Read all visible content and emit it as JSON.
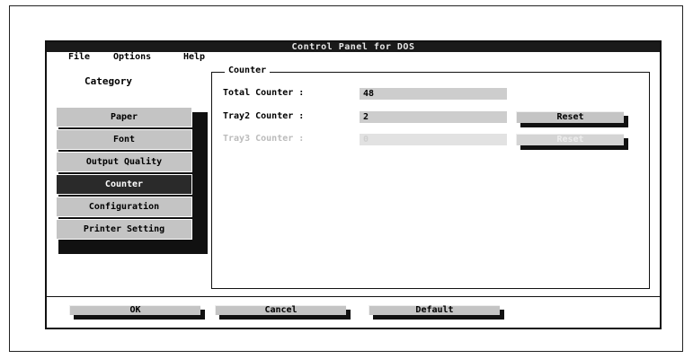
{
  "window": {
    "title": "Control Panel for DOS"
  },
  "menu": {
    "items": [
      "File",
      "Options",
      "Help"
    ]
  },
  "sidebar": {
    "heading": "Category",
    "items": [
      "Paper",
      "Font",
      "Output Quality",
      "Counter",
      "Configuration",
      "Printer Setting"
    ],
    "selected": "Counter"
  },
  "counter": {
    "group_title": "Counter",
    "rows": [
      {
        "label": "Total Counter :",
        "value": "48",
        "enabled": true
      },
      {
        "label": "Tray2 Counter :",
        "value": "2",
        "enabled": true,
        "button": "Reset"
      },
      {
        "label": "Tray3 Counter :",
        "value": "0",
        "enabled": false,
        "button": "Reset"
      }
    ]
  },
  "footer": {
    "ok": "OK",
    "cancel": "Cancel",
    "default": "Default"
  },
  "colors": {
    "titlebar": "#1a1a1a",
    "button_face": "#c4c4c4",
    "selected": "#2a2a2a",
    "disabled_text": "#bbbbbb"
  }
}
